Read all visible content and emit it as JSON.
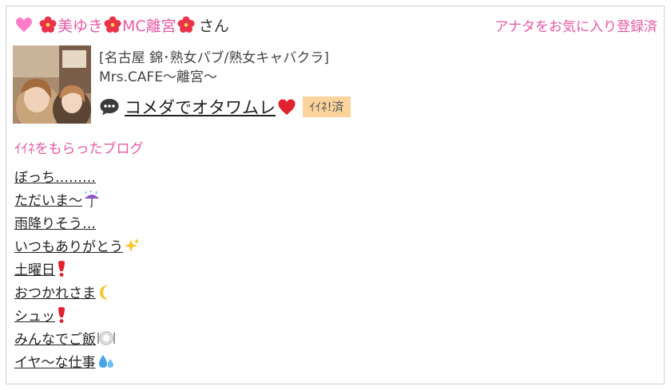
{
  "header": {
    "name_parts": [
      "美ゆき",
      "MC離宮"
    ],
    "honorific": "さん",
    "favorite_status": "アナタをお気に入り登録済",
    "accent_color": "#e45aa6"
  },
  "profile": {
    "category": "[名古屋 錦･熟女パブ/熟女キャバクラ]",
    "shop_name": "Mrs.CAFE〜離宮〜",
    "latest_post": "コメダでオタワムレ",
    "like_badge": "ｲｲﾈ!済",
    "badge_color": "#fbd39d"
  },
  "liked_blogs": {
    "title": "ｲｲﾈをもらったブログ",
    "items": [
      {
        "text": "ぼっち………",
        "icon": ""
      },
      {
        "text": "ただいま〜",
        "icon": "umbrella-rain-icon"
      },
      {
        "text": "雨降りそう…",
        "icon": ""
      },
      {
        "text": "いつもありがとう",
        "icon": "sparkles-icon"
      },
      {
        "text": "土曜日",
        "icon": "exclamation-icon"
      },
      {
        "text": "おつかれさま",
        "icon": "crescent-moon-icon"
      },
      {
        "text": "シュッ",
        "icon": "exclamation-icon"
      },
      {
        "text": "みんなでご飯",
        "icon": "plate-icon"
      },
      {
        "text": "イヤ〜な仕事",
        "icon": "sweat-droplets-icon"
      }
    ]
  }
}
